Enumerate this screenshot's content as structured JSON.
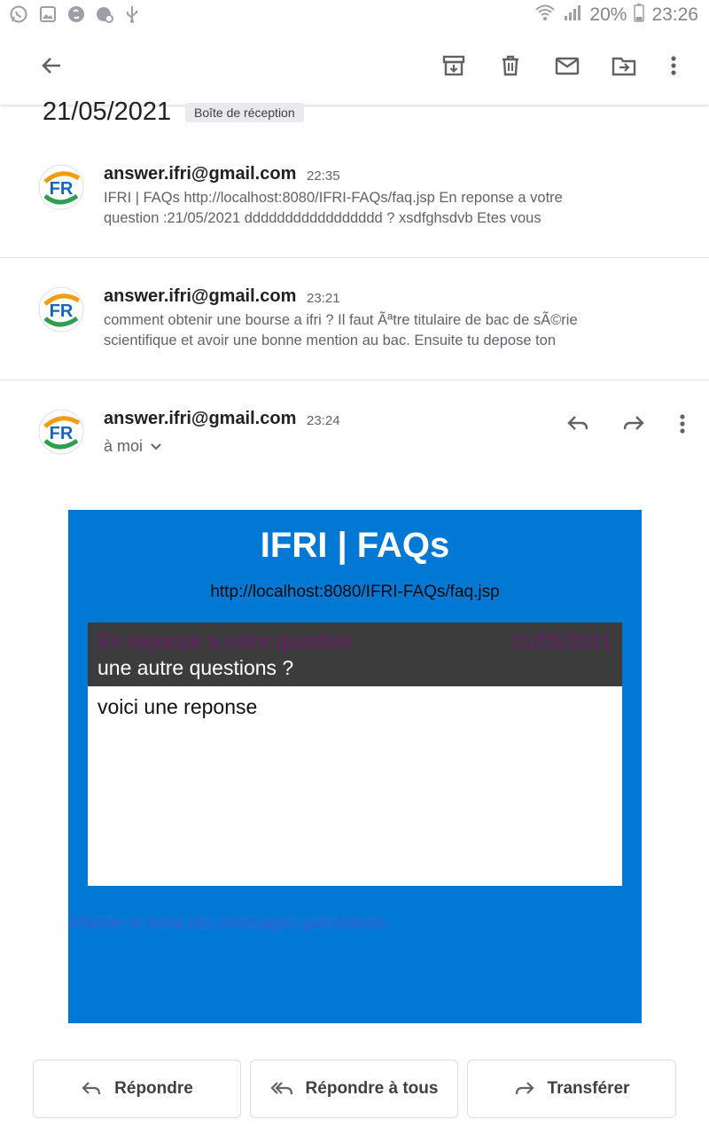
{
  "status_bar": {
    "battery": "20%",
    "time": "23:26"
  },
  "thread": {
    "date": "21/05/2021",
    "label": "Boîte de réception"
  },
  "messages": [
    {
      "sender": "answer.ifri@gmail.com",
      "time": "22:35",
      "snippet_line1": "IFRI | FAQs http://localhost:8080/IFRI-FAQs/faq.jsp En reponse a votre",
      "snippet_line2": "question :21/05/2021 ddddddddddddddddd ? xsdfghsdvb Etes vous"
    },
    {
      "sender": "answer.ifri@gmail.com",
      "time": "23:21",
      "snippet_line1": "comment obtenir une bourse a ifri ? Il faut Ãªtre titulaire de bac de sÃ©rie",
      "snippet_line2": "scientifique et avoir une bonne mention au bac. Ensuite tu depose ton"
    },
    {
      "sender": "answer.ifri@gmail.com",
      "time": "23:24",
      "recipient": "à moi"
    }
  ],
  "avatar_text": "FR",
  "email_body": {
    "title": "IFRI | FAQs",
    "link": "http://localhost:8080/IFRI-FAQs/faq.jsp",
    "question_intro": "En reponse a votre question :",
    "question_date": "21/05/2021",
    "question_text": "une autre questions ?",
    "answer_text": "voici une reponse",
    "show_previous": "Afficher le texte des messages précédents"
  },
  "actions": {
    "reply": "Répondre",
    "reply_all": "Répondre à tous",
    "forward": "Transférer"
  },
  "colors": {
    "card_blue": "#0078d4",
    "question_intro": "#6a1b6a",
    "link_blue": "#3a5fd0"
  }
}
